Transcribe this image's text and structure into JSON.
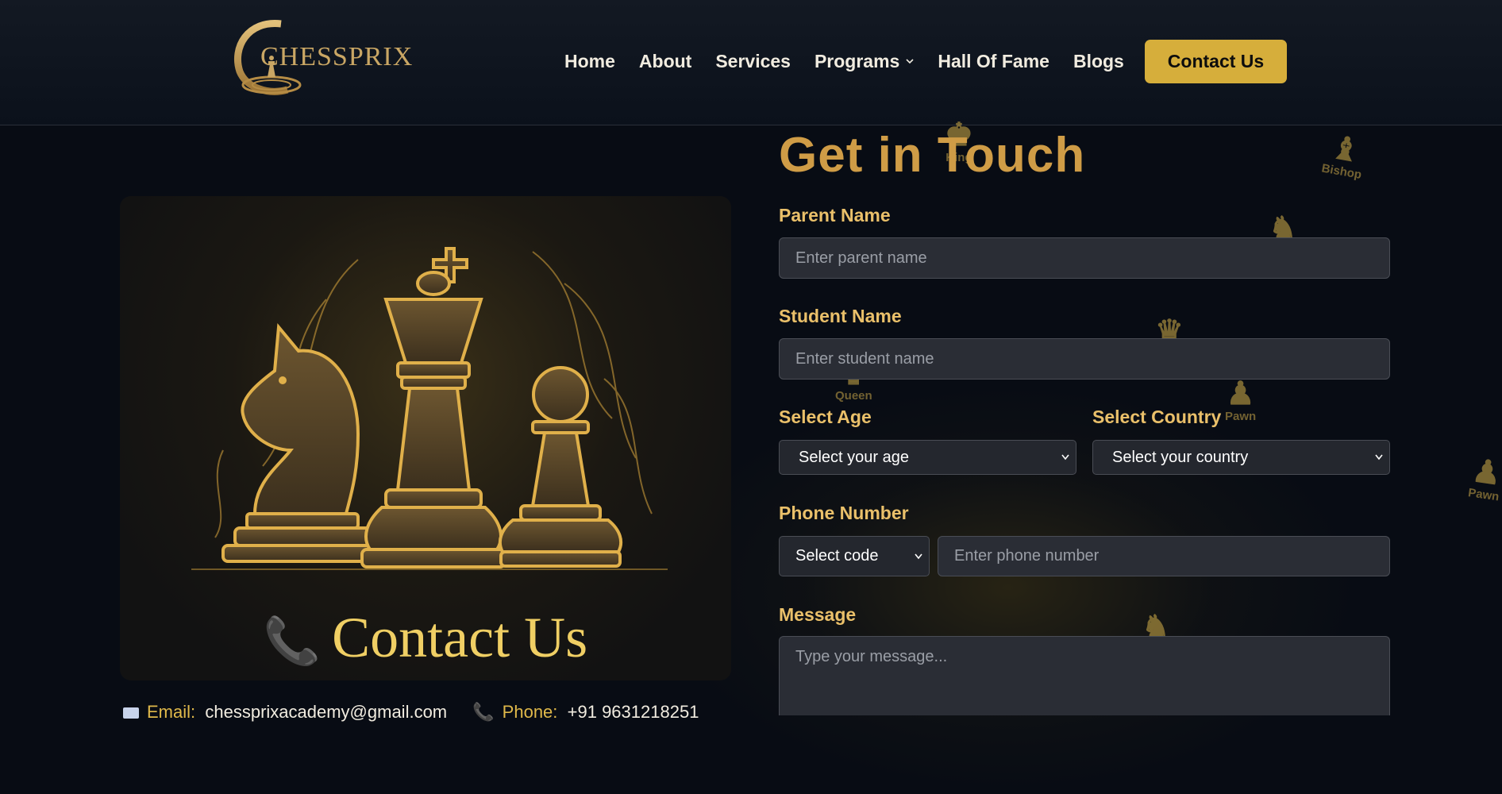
{
  "brand": {
    "name": "Chessprix",
    "logo_text": "CHESSPRIX"
  },
  "nav": {
    "items": [
      {
        "label": "Home"
      },
      {
        "label": "About"
      },
      {
        "label": "Services"
      },
      {
        "label": "Programs",
        "has_dropdown": true
      },
      {
        "label": "Hall Of Fame"
      },
      {
        "label": "Blogs"
      }
    ],
    "cta_label": "Contact Us"
  },
  "decor_pieces": [
    "King",
    "Bishop",
    "Queen",
    "Pawn",
    "Pawn"
  ],
  "card": {
    "title": "Contact Us",
    "phone_icon": "phone-icon"
  },
  "contact": {
    "email_label": "Email:",
    "email_value": "chessprixacademy@gmail.com",
    "phone_label": "Phone:",
    "phone_value": "+91 9631218251"
  },
  "form": {
    "title": "Get in Touch",
    "parent_name": {
      "label": "Parent Name",
      "placeholder": "Enter parent name"
    },
    "student_name": {
      "label": "Student Name",
      "placeholder": "Enter student name"
    },
    "age": {
      "label": "Select Age",
      "selected": "Select your age"
    },
    "country": {
      "label": "Select Country",
      "selected": "Select your country"
    },
    "phone": {
      "label": "Phone Number",
      "code_selected": "Select code",
      "placeholder": "Enter phone number"
    },
    "message": {
      "label": "Message",
      "placeholder": "Type your message..."
    }
  },
  "colors": {
    "background": "#080c14",
    "accent_gold": "#d6ae3b",
    "heading_gold": "#cf9c46",
    "label_gold": "#eac06a",
    "input_bg": "#2a2d35"
  }
}
